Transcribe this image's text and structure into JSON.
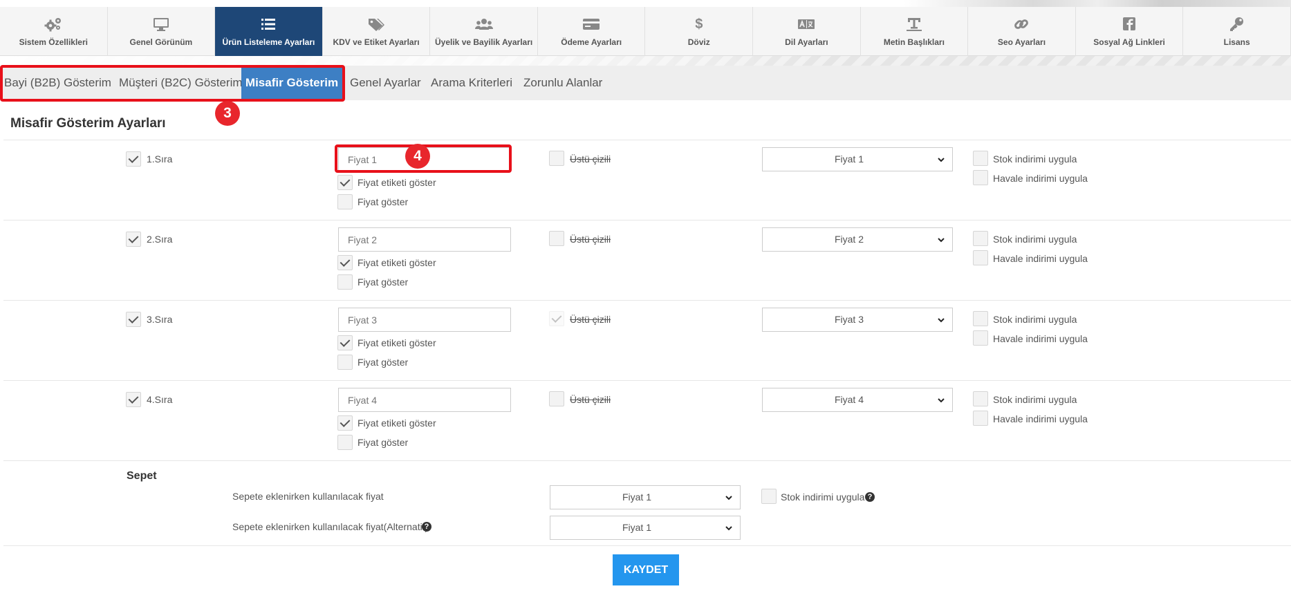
{
  "nav": {
    "items": [
      {
        "label": "Sistem Özellikleri",
        "icon": "gears-icon"
      },
      {
        "label": "Genel Görünüm",
        "icon": "monitor-icon"
      },
      {
        "label": "Ürün Listeleme Ayarları",
        "icon": "list-icon",
        "active": true
      },
      {
        "label": "KDV ve Etiket Ayarları",
        "icon": "tags-icon"
      },
      {
        "label": "Üyelik ve Bayilik Ayarları",
        "icon": "users-icon"
      },
      {
        "label": "Ödeme Ayarları",
        "icon": "credit-card-icon"
      },
      {
        "label": "Döviz",
        "icon": "dollar-icon"
      },
      {
        "label": "Dil Ayarları",
        "icon": "language-icon"
      },
      {
        "label": "Metin Başlıkları",
        "icon": "text-height-icon"
      },
      {
        "label": "Seo Ayarları",
        "icon": "link-icon"
      },
      {
        "label": "Sosyal Ağ Linkleri",
        "icon": "facebook-icon"
      },
      {
        "label": "Lisans",
        "icon": "key-icon"
      }
    ]
  },
  "tabs": {
    "items": [
      {
        "label": "Bayi (B2B) Gösterim"
      },
      {
        "label": "Müşteri (B2C) Gösterim"
      },
      {
        "label": "Misafir Gösterim",
        "active": true
      },
      {
        "label": "Genel Ayarlar"
      },
      {
        "label": "Arama Kriterleri"
      },
      {
        "label": "Zorunlu Alanlar"
      }
    ]
  },
  "annotations": {
    "badge3": "3",
    "badge4": "4"
  },
  "section_title": "Misafir Gösterim Ayarları",
  "rows": [
    {
      "label": "1.Sıra",
      "placeholder": "Fiyat 1",
      "show_price_label": "Fiyat etiketi göster",
      "show_price": "Fiyat göster",
      "strike": "Üstü çizili",
      "select": "Fiyat 1",
      "stock_discount": "Stok indirimi uygula",
      "transfer_discount": "Havale indirimi uygula"
    },
    {
      "label": "2.Sıra",
      "placeholder": "Fiyat 2",
      "show_price_label": "Fiyat etiketi göster",
      "show_price": "Fiyat göster",
      "strike": "Üstü çizili",
      "select": "Fiyat 2",
      "stock_discount": "Stok indirimi uygula",
      "transfer_discount": "Havale indirimi uygula"
    },
    {
      "label": "3.Sıra",
      "placeholder": "Fiyat 3",
      "show_price_label": "Fiyat etiketi göster",
      "show_price": "Fiyat göster",
      "strike": "Üstü çizili",
      "select": "Fiyat 3",
      "stock_discount": "Stok indirimi uygula",
      "transfer_discount": "Havale indirimi uygula"
    },
    {
      "label": "4.Sıra",
      "placeholder": "Fiyat 4",
      "show_price_label": "Fiyat etiketi göster",
      "show_price": "Fiyat göster",
      "strike": "Üstü çizili",
      "select": "Fiyat 4",
      "stock_discount": "Stok indirimi uygula",
      "transfer_discount": "Havale indirimi uygula"
    }
  ],
  "sepet": {
    "title": "Sepet",
    "price_label": "Sepete eklenirken kullanılacak fiyat",
    "price_select": "Fiyat 1",
    "stock_discount": "Stok indirimi uygula",
    "alt_label": "Sepete eklenirken kullanılacak fiyat(Alternatif)",
    "alt_select": "Fiyat 1",
    "help": "?"
  },
  "save_label": "KAYDET",
  "colors": {
    "nav_active": "#1e4777",
    "tab_active": "#3d7fc4",
    "annotation": "#e8101a",
    "save_button": "#2496ee"
  }
}
